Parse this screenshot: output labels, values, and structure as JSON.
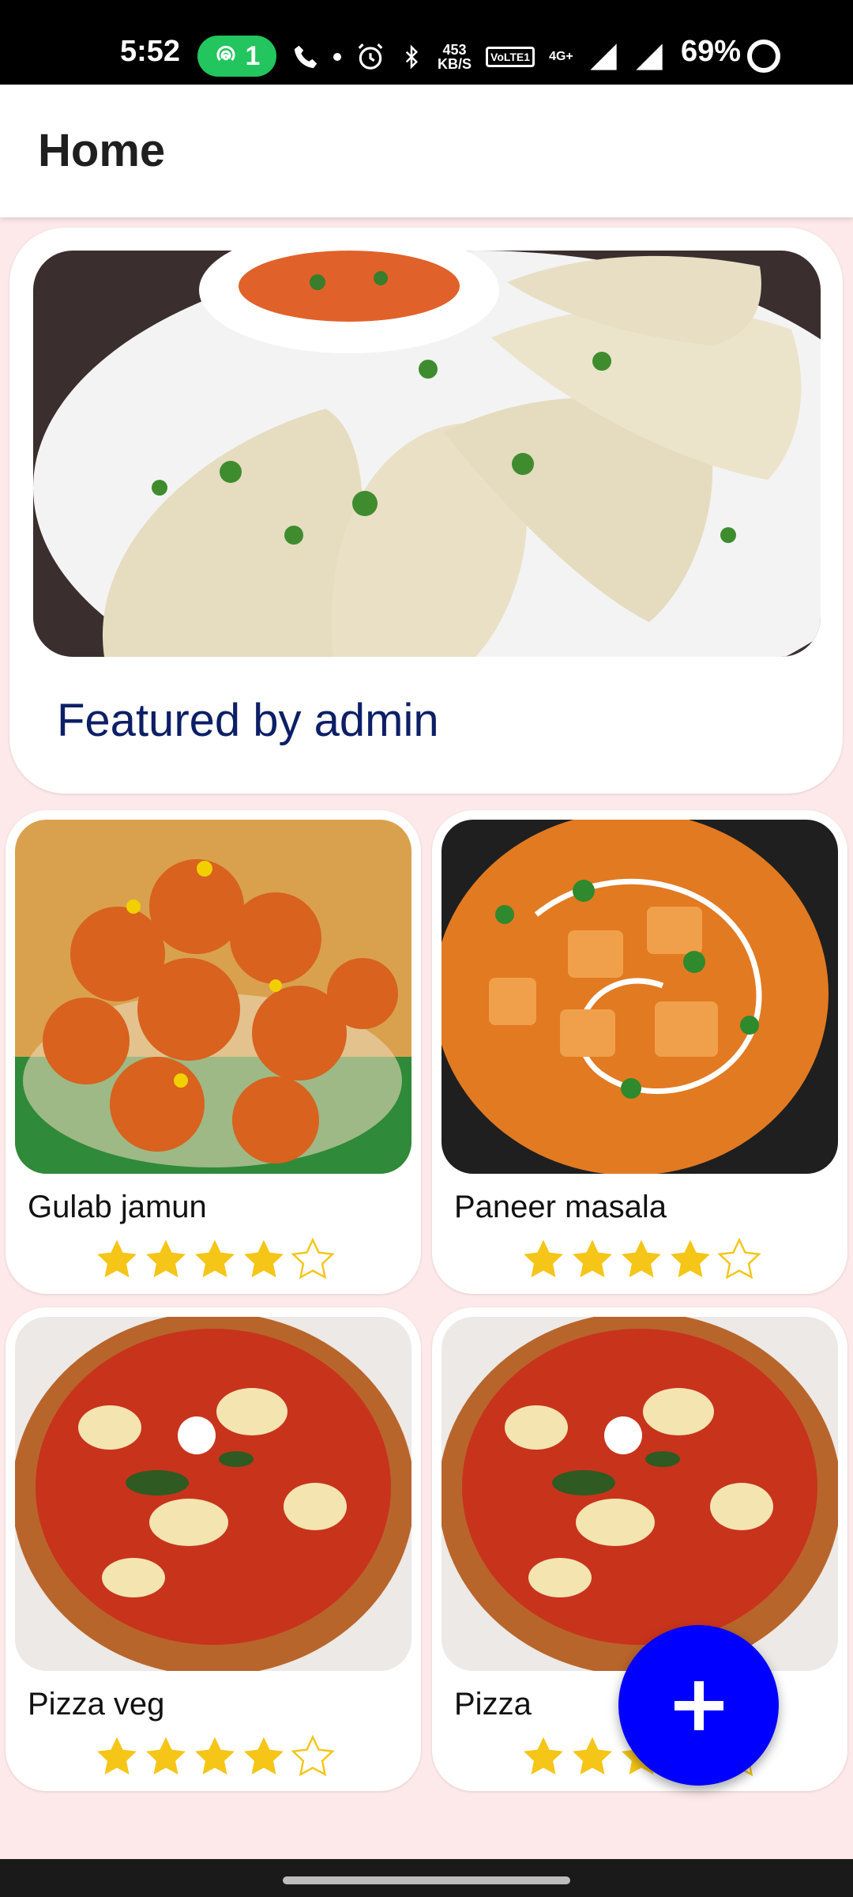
{
  "status_bar": {
    "time": "5:52",
    "hotspot_count": "1",
    "net_speed_top": "453",
    "net_speed_bottom": "KB/S",
    "volte_label": "VoLTE1",
    "network": "4G+",
    "battery": "69%"
  },
  "app_bar": {
    "title": "Home"
  },
  "featured": {
    "label": "Featured by admin"
  },
  "items": [
    {
      "name": "Gulab jamun",
      "rating": 4,
      "max_rating": 5
    },
    {
      "name": "Paneer masala",
      "rating": 4,
      "max_rating": 5
    },
    {
      "name": "Pizza veg",
      "rating": 4,
      "max_rating": 5
    },
    {
      "name": "Pizza",
      "rating": 4,
      "max_rating": 5
    }
  ],
  "fab": {
    "icon": "plus-icon",
    "color": "#0000ff"
  },
  "colors": {
    "background": "#fde9e9",
    "star": "#f5c518",
    "featured_text": "#0c1f66"
  }
}
